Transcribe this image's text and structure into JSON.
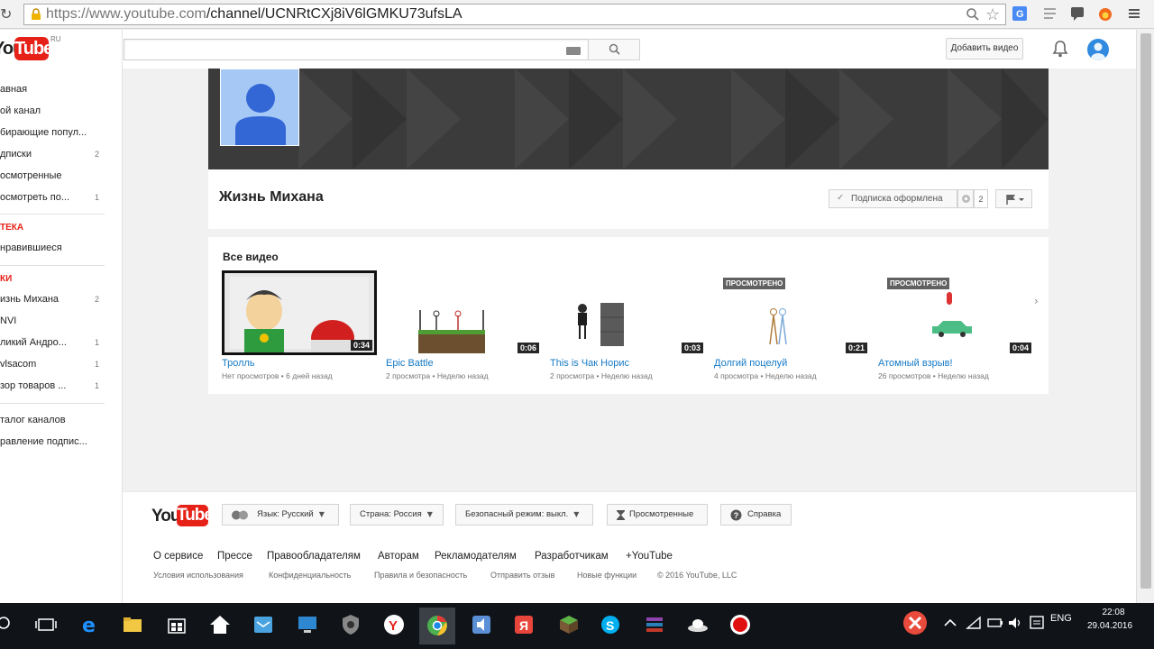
{
  "browser": {
    "url_prefix": "https://www.youtube.com",
    "url_path": "/channel/UCNRtCXj8iV6lGMKU73ufsLA"
  },
  "sidebar": {
    "logo_you": "You",
    "logo_tube": "Tube",
    "logo_region": "RU",
    "items": [
      {
        "label": "авная",
        "count": ""
      },
      {
        "label": "ой канал",
        "count": ""
      },
      {
        "label": "бирающие попул...",
        "count": ""
      },
      {
        "label": "дписки",
        "count": "2"
      },
      {
        "label": "осмотренные",
        "count": ""
      },
      {
        "label": "осмотреть по...",
        "count": "1"
      }
    ],
    "library_header": "ТЕКА",
    "library_items": [
      {
        "label": "нравившиеся",
        "count": ""
      }
    ],
    "subs_header": "КИ",
    "subs_items": [
      {
        "label": "изнь Михана",
        "count": "2"
      },
      {
        "label": "NVI",
        "count": ""
      },
      {
        "label": "ликий Андро...",
        "count": "1"
      },
      {
        "label": "vlsacom",
        "count": "1"
      },
      {
        "label": "зор товаров ...",
        "count": "1"
      }
    ],
    "bottom_items": [
      {
        "label": "талог каналов"
      },
      {
        "label": "равление подпис..."
      }
    ]
  },
  "masthead": {
    "upload_label": "Добавить видео"
  },
  "channel": {
    "title": "Жизнь Михана",
    "subscribe_label": "Подписка оформлена",
    "subscriber_count": "2"
  },
  "videos": {
    "section_title": "Все видео",
    "items": [
      {
        "title": "Тролль",
        "views": "Нет просмотров",
        "age": "6 дней назад",
        "duration": "0:34",
        "watched": ""
      },
      {
        "title": "Epic Battle",
        "views": "2 просмотра",
        "age": "Неделю назад",
        "duration": "0:06",
        "watched": ""
      },
      {
        "title": "This is Чак Норис",
        "views": "2 просмотра",
        "age": "Неделю назад",
        "duration": "0:03",
        "watched": ""
      },
      {
        "title": "Долгий поцелуй",
        "views": "4 просмотра",
        "age": "Неделю назад",
        "duration": "0:21",
        "watched": "ПРОСМОТРЕНО"
      },
      {
        "title": "Атомный взрыв!",
        "views": "26 просмотров",
        "age": "Неделю назад",
        "duration": "0:04",
        "watched": "ПРОСМОТРЕНО"
      }
    ],
    "meta_separator": "•"
  },
  "footer": {
    "logo_you": "You",
    "logo_tube": "Tube",
    "language_label": "Язык: Русский",
    "country_label": "Страна: Россия",
    "safety_label": "Безопасный режим: выкл.",
    "history_label": "Просмотренные",
    "help_label": "Справка",
    "links": [
      "О сервисе",
      "Прессе",
      "Правообладателям",
      "Авторам",
      "Рекламодателям",
      "Разработчикам",
      "+YouTube"
    ],
    "small_links": [
      "Условия использования",
      "Конфиденциальность",
      "Правила и безопасность",
      "Отправить отзыв",
      "Новые функции",
      "© 2016 YouTube, LLC"
    ]
  },
  "taskbar": {
    "language": "ENG",
    "time": "22:08",
    "date": "29.04.2016"
  },
  "colors": {
    "youtube_red": "#e62117",
    "link_blue": "#167ac6",
    "banner_dark": "#3a3a3a",
    "taskbar": "#101318"
  },
  "icons": [
    "reload-icon",
    "lock-icon",
    "zoom-icon",
    "bookmark-star-icon",
    "translate-icon",
    "menu-icon",
    "search-icon",
    "keyboard-icon",
    "bell-icon",
    "avatar-icon",
    "check-icon",
    "gear-icon",
    "flag-icon",
    "chevron-right-icon",
    "hourglass-icon",
    "help-icon"
  ]
}
